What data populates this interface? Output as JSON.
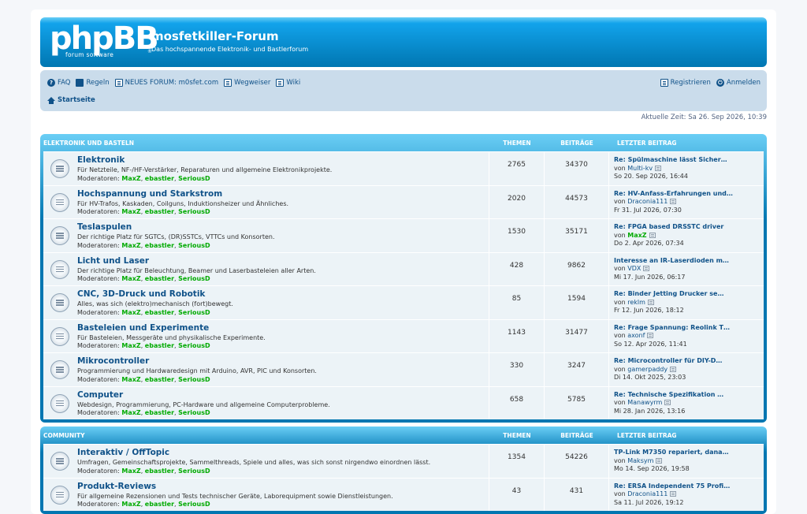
{
  "header": {
    "logo_text": "phpBB",
    "logo_sub": "forum software",
    "logo_reg": "®",
    "site_title": "mosfetkiller-Forum",
    "site_description": "Das hochspannende Elektronik- und Bastlerforum"
  },
  "nav": {
    "faq": "FAQ",
    "rules": "Regeln",
    "new_forum": "NEUES FORUM: m0sfet.com",
    "guide": "Wegweiser",
    "wiki": "Wiki",
    "register": "Registrieren",
    "login": "Anmelden",
    "home": "Startseite"
  },
  "current_time": "Aktuelle Zeit: Sa 26. Sep 2026, 10:39",
  "mods_label": "Moderatoren:",
  "mods": [
    "MaxZ",
    "ebastler",
    "SeriousD"
  ],
  "by_label": "von",
  "categories": [
    {
      "name": "ELEKTRONIK UND BASTELN",
      "col_topics": "THEMEN",
      "col_posts": "BEITRÄGE",
      "col_last": "LETZTER BEITRAG",
      "forums": [
        {
          "title": "Elektronik",
          "desc": "Für Netzteile, NF-/HF-Verstärker, Reparaturen und allgemeine Elektronikprojekte.",
          "topics": "2765",
          "posts": "34370",
          "last_title": "Re: Spülmaschine lässt Sicher…",
          "last_user": "Multi-kv",
          "last_user_green": false,
          "last_date": "So 20. Sep 2026, 16:44"
        },
        {
          "title": "Hochspannung und Starkstrom",
          "desc": "Für HV-Trafos, Kaskaden, Coilguns, Induktionsheizer und Ähnliches.",
          "topics": "2020",
          "posts": "44573",
          "last_title": "Re: HV-Anfass-Erfahrungen und…",
          "last_user": "Draconia111",
          "last_user_green": false,
          "last_date": "Fr 31. Jul 2026, 07:30"
        },
        {
          "title": "Teslaspulen",
          "desc": "Der richtige Platz für SGTCs, (DR)SSTCs, VTTCs und Konsorten.",
          "topics": "1530",
          "posts": "35171",
          "last_title": "Re: FPGA based DRSSTC driver",
          "last_user": "MaxZ",
          "last_user_green": true,
          "last_date": "Do 2. Apr 2026, 07:34"
        },
        {
          "title": "Licht und Laser",
          "desc": "Der richtige Platz für Beleuchtung, Beamer und Laserbasteleien aller Arten.",
          "topics": "428",
          "posts": "9862",
          "last_title": "Interesse an IR-Laserdioden m…",
          "last_user": "VDX",
          "last_user_green": false,
          "last_date": "Mi 17. Jun 2026, 06:17"
        },
        {
          "title": "CNC, 3D-Druck und Robotik",
          "desc": "Alles, was sich (elektro)mechanisch (fort)bewegt.",
          "topics": "85",
          "posts": "1594",
          "last_title": "Re: Binder Jetting Drucker se…",
          "last_user": "reklm",
          "last_user_green": false,
          "last_date": "Fr 12. Jun 2026, 18:12"
        },
        {
          "title": "Basteleien und Experimente",
          "desc": "Für Basteleien, Messgeräte und physikalische Experimente.",
          "topics": "1143",
          "posts": "31477",
          "last_title": "Re: Frage Spannung: Reolink T…",
          "last_user": "axonf",
          "last_user_green": false,
          "last_date": "So 12. Apr 2026, 11:41"
        },
        {
          "title": "Mikrocontroller",
          "desc": "Programmierung und Hardwaredesign mit Arduino, AVR, PIC und Konsorten.",
          "topics": "330",
          "posts": "3247",
          "last_title": "Re: Microcontroller für DIY-D…",
          "last_user": "gamerpaddy",
          "last_user_green": false,
          "last_date": "Di 14. Okt 2025, 23:03"
        },
        {
          "title": "Computer",
          "desc": "Webdesign, Programmierung, PC-Hardware und allgemeine Computerprobleme.",
          "topics": "658",
          "posts": "5785",
          "last_title": "Re: Technische Spezifikation …",
          "last_user": "Manawyrm",
          "last_user_green": false,
          "last_date": "Mi 28. Jan 2026, 13:16"
        }
      ]
    },
    {
      "name": "COMMUNITY",
      "col_topics": "THEMEN",
      "col_posts": "BEITRÄGE",
      "col_last": "LETZTER BEITRAG",
      "forums": [
        {
          "title": "Interaktiv / OffTopic",
          "desc": "Umfragen, Gemeinschaftsprojekte, Sammelthreads, Spiele und alles, was sich sonst nirgendwo einordnen lässt.",
          "topics": "1354",
          "posts": "54226",
          "last_title": "TP-Link M7350 repariert, dana…",
          "last_user": "Maksym",
          "last_user_green": false,
          "last_date": "Mo 14. Sep 2026, 19:58"
        },
        {
          "title": "Produkt-Reviews",
          "desc": "Für allgemeine Rezensionen und Tests technischer Geräte, Laborequipment sowie Dienstleistungen.",
          "topics": "43",
          "posts": "431",
          "last_title": "Re: ERSA Independent 75 Profi…",
          "last_user": "Draconia111",
          "last_user_green": false,
          "last_date": "Sa 11. Jul 2026, 19:12"
        }
      ]
    }
  ]
}
